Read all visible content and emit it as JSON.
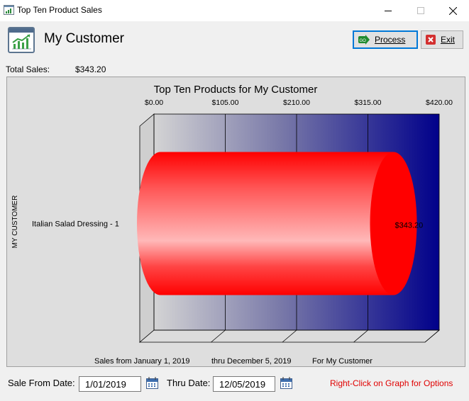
{
  "window": {
    "title": "Top Ten Product Sales"
  },
  "header": {
    "title": "My Customer"
  },
  "toolbar": {
    "process_label": "Process",
    "exit_label": "Exit"
  },
  "summary": {
    "total_label": "Total Sales:",
    "total_value": "$343.20"
  },
  "chart_data": {
    "type": "bar",
    "orientation": "horizontal",
    "title": "Top Ten Products for My Customer",
    "axis_ticks": [
      "$0.00",
      "$105.00",
      "$210.00",
      "$315.00",
      "$420.00"
    ],
    "xlim": [
      0,
      420
    ],
    "ylabel": "MY CUSTOMER",
    "categories": [
      "Italian Salad Dressing - 1"
    ],
    "values": [
      343.2
    ],
    "value_labels": [
      "$343.20"
    ],
    "footer_from": "Sales from January  1, 2019",
    "footer_thru": "thru December  5, 2019",
    "footer_for": "For My Customer",
    "grid": true,
    "bar_color": "#ff0000",
    "background_gradient": [
      "#d4d4d4",
      "#00008a"
    ]
  },
  "filters": {
    "from_label": "Sale From Date:",
    "from_value": "1/01/2019",
    "thru_label": "Thru Date:",
    "thru_value": "12/05/2019"
  },
  "hint": "Right-Click on Graph for Options"
}
